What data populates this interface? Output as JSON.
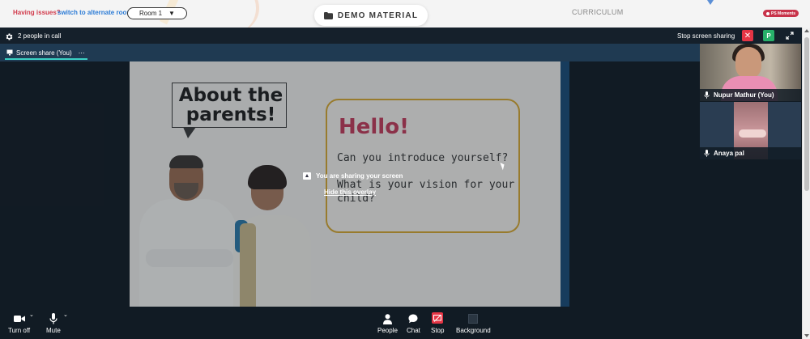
{
  "topbar": {
    "issues_text": "Having issues?",
    "alternate_link": "switch to alternate room",
    "room_select": "Room 1",
    "demo_button": "DEMO MATERIAL",
    "curriculum": "CURRICULUM",
    "ps_badge": "PS Moments"
  },
  "call": {
    "people_count": "2 people in call",
    "stop_sharing_label": "Stop screen sharing",
    "avatar_letter": "P"
  },
  "tab": {
    "label": "Screen share (You)",
    "more": "⋯"
  },
  "slide": {
    "about_title": "About the parents!",
    "hello": "Hello!",
    "question1": "Can you introduce yourself?",
    "question2": "What is your vision for your child?"
  },
  "overlay": {
    "message": "You are sharing your screen",
    "hide_link": "Hide this overlay"
  },
  "participants": [
    {
      "name": "Nupur Mathur (You)"
    },
    {
      "name": "Anaya pal"
    }
  ],
  "toolbar": {
    "camera": "Turn off",
    "mic": "Mute",
    "people": "People",
    "chat": "Chat",
    "stop": "Stop",
    "background": "Background"
  },
  "colors": {
    "danger": "#e53545",
    "accent_green": "#27b06a",
    "tab_underline": "#3bd0c4",
    "hello_red": "#c43b5a",
    "card_border": "#d8a832"
  }
}
